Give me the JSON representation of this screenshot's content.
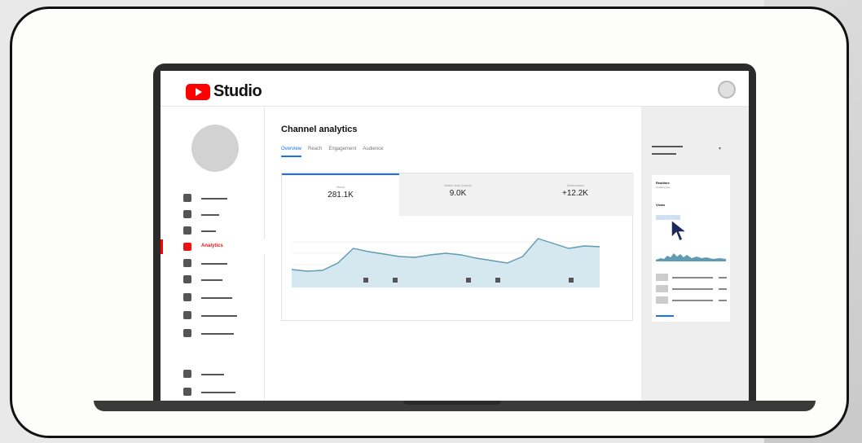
{
  "app": {
    "title": "Studio"
  },
  "nav": {
    "active_label": "Analytics"
  },
  "page": {
    "title": "Channel analytics",
    "tabs": [
      "Overview",
      "Reach",
      "Engagement",
      "Audience"
    ],
    "active_tab": 0
  },
  "metrics": [
    {
      "label": "Views",
      "value": "281.1K"
    },
    {
      "label": "Watch time (hours)",
      "value": "9.0K"
    },
    {
      "label": "Subscribers",
      "value": "+12.2K"
    }
  ],
  "chart_data": {
    "type": "area",
    "x": [
      0,
      1,
      2,
      3,
      4,
      5,
      6,
      7,
      8,
      9,
      10,
      11,
      12,
      13,
      14,
      15,
      16,
      17,
      18,
      19,
      20
    ],
    "values": [
      22,
      20,
      21,
      30,
      48,
      44,
      41,
      38,
      37,
      40,
      42,
      40,
      36,
      33,
      30,
      38,
      60,
      54,
      48,
      51,
      50
    ],
    "ylim": [
      0,
      70
    ],
    "grid": true
  },
  "right_panel": {
    "title": "Realtime",
    "subtitle": "Updating live",
    "section": "Views"
  },
  "colors": {
    "accent": "#1a73e8",
    "brand": "#ff0000",
    "chart_fill": "#d6e8ef",
    "chart_line": "#5f9bb4"
  }
}
